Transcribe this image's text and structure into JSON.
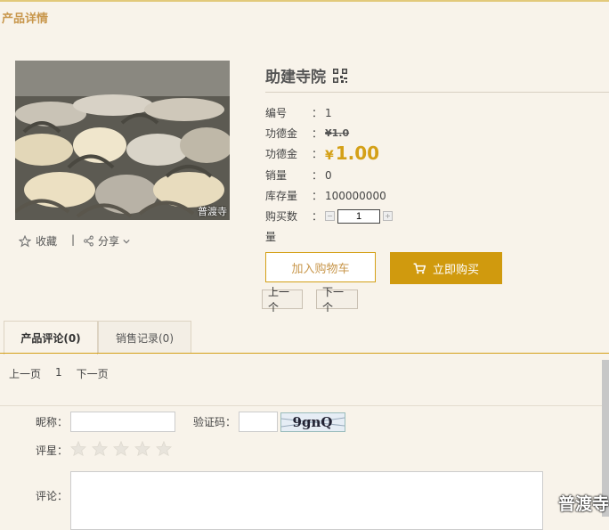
{
  "page": {
    "title": "产品详情"
  },
  "image": {
    "watermark": "普渡寺"
  },
  "actions": {
    "favorite": "收藏",
    "separator": "|",
    "share": "分享"
  },
  "product": {
    "name": "助建寺院",
    "attrs": {
      "code_label": "编号",
      "code_value": "1",
      "merit_label": "功德金",
      "merit_old": "¥1.0",
      "merit2_label": "功德金",
      "merit_currency": "¥",
      "merit_new": "1.00",
      "sales_label": "销量",
      "sales_value": "0",
      "stock_label": "库存量",
      "stock_value": "100000000",
      "qty_label": "购买数",
      "qty_label_tail": "量",
      "qty_value": "1",
      "colon": "："
    },
    "buttons": {
      "add_cart": "加入购物车",
      "buy_now": "立即购买",
      "prev": "上一个",
      "next": "下一个"
    }
  },
  "tabs": [
    {
      "label": "产品评论(0)",
      "active": true
    },
    {
      "label": "销售记录(0)",
      "active": false
    }
  ],
  "pager": {
    "prev": "上一页",
    "current": "1",
    "next": "下一页"
  },
  "comment_form": {
    "nickname_label": "昵称：",
    "captcha_label": "验证码：",
    "captcha_text": "9gnQ",
    "rating_label": "评星：",
    "rating": 0,
    "rating_max": 5,
    "comment_label": "评论："
  },
  "corner_watermark": "普渡寺",
  "colors": {
    "accent": "#d4a017",
    "title": "#c8974c",
    "background": "#f8f3ea"
  },
  "icons": [
    "qr-code-icon",
    "star-outline-icon",
    "share-icon",
    "chevron-down-icon",
    "cart-icon"
  ]
}
